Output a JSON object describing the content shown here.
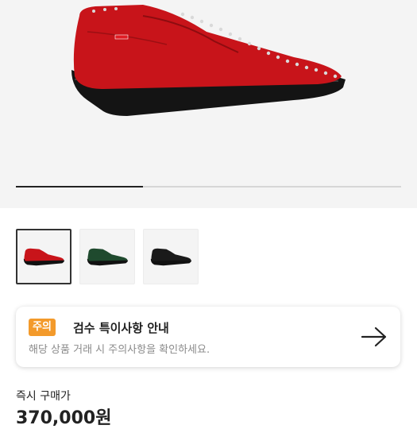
{
  "gallery": {
    "main_image_icon": "red-studded-penny-loafer",
    "progress": 0.33,
    "thumbnails": [
      {
        "icon": "red-loafer-thumbnail",
        "color": "#c8141a",
        "selected": true
      },
      {
        "icon": "green-loafer-thumbnail",
        "color": "#1f4a2e",
        "selected": false
      },
      {
        "icon": "black-loafer-thumbnail",
        "color": "#1a1a1a",
        "selected": false
      }
    ]
  },
  "notice": {
    "badge": "주의",
    "title": "검수 특이사항 안내",
    "subtitle": "해당 상품 거래 시 주의사항을 확인하세요.",
    "arrow_icon": "arrow-right-icon",
    "badge_color": "#f39a2b"
  },
  "price": {
    "label": "즉시 구매가",
    "value": "370,000원"
  }
}
